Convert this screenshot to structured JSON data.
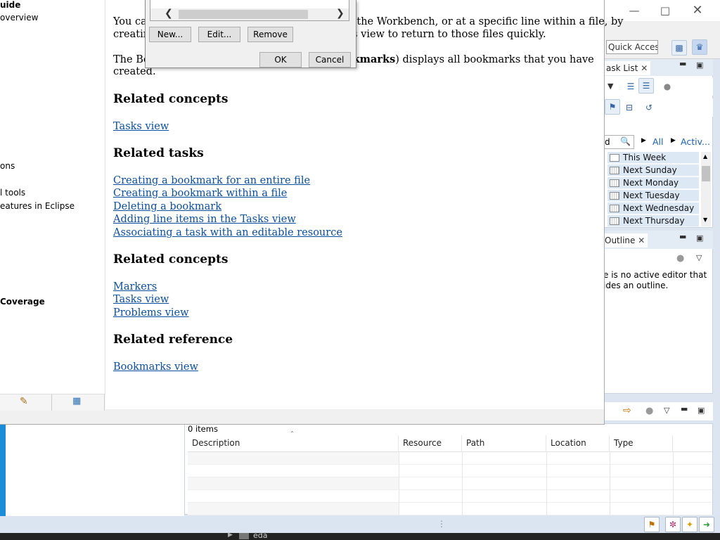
{
  "eclipse": {
    "quick_access": "Quick Access",
    "task_list_tab": "ask List",
    "outline_tab": "Outline",
    "outline_message_line1": "e is no active editor that",
    "outline_message_line2": "ides an outline.",
    "filter_all": "All",
    "filter_active": "Activ...",
    "search_partial": "d",
    "calendar_items": [
      "This Week",
      "Next Sunday",
      "Next Monday",
      "Next Tuesday",
      "Next Wednesday",
      "Next Thursday"
    ],
    "tasks_count": "0 items",
    "columns": [
      "Description",
      "Resource",
      "Path",
      "Location",
      "Type"
    ],
    "bottom_project": "eda"
  },
  "help": {
    "toc": [
      "uide",
      "overview",
      "ons",
      "l tools",
      "eatures in Eclipse",
      " Coverage"
    ],
    "content": {
      "para1_a": "You ca",
      "para1_b": " the Workbench, or at a specific line within a file, by",
      "para1_c": "creatin",
      "para1_d": "s view to return to those files quickly.",
      "para2_a": "The Bo",
      "para2_b": "kmarks",
      "para2_c": ") displays all bookmarks that you have",
      "para2_d": "created.",
      "h_related_concepts_1": "Related concepts",
      "link_tasks_view_1": "Tasks view",
      "h_related_tasks": "Related tasks",
      "task_links": [
        "Creating a bookmark for an entire file",
        "Creating a bookmark within a file",
        "Deleting a bookmark",
        "Adding line items in the Tasks view",
        "Associating a task with an editable resource"
      ],
      "h_related_concepts_2": "Related concepts",
      "concept_links": [
        "Markers",
        "Tasks view",
        "Problems view"
      ],
      "h_related_reference": "Related reference",
      "link_bookmarks_view": "Bookmarks view"
    }
  },
  "dialog": {
    "new": "New...",
    "edit": "Edit...",
    "remove": "Remove",
    "ok": "OK",
    "cancel": "Cancel"
  }
}
